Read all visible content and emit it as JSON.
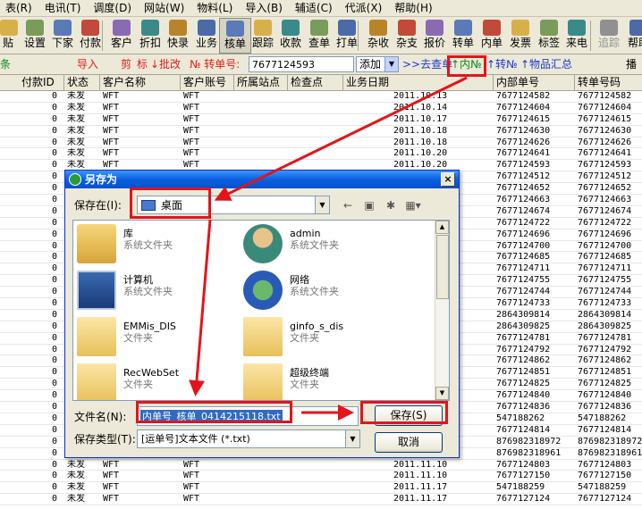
{
  "menu": [
    "表(R)",
    "电讯(T)",
    "调度(D)",
    "网站(W)",
    "物料(L)",
    "导入(B)",
    "辅适(C)",
    "代派(X)",
    "帮助(H)"
  ],
  "toolbar": {
    "items": [
      "贴",
      "设置",
      "下家",
      "付款",
      "客户",
      "折扣",
      "快录",
      "业务",
      "核单",
      "跟踪",
      "收款",
      "查单",
      "打单",
      "杂收",
      "杂支",
      "报价",
      "转单",
      "内单",
      "发票",
      "标签",
      "来电",
      "追踪",
      "帮助"
    ]
  },
  "filterbar": {
    "leading": "条",
    "import_label": "导入",
    "cut_label": "剪",
    "mark_label": "标",
    "batch_label": "↓批改",
    "tracking_label": "№ 转单号:",
    "tracking_value": "7677124593",
    "add_value": "添加",
    "goto_label": ">>去查单",
    "inner_label": "↑内№",
    "transfer_label": "↑转№",
    "summary_label": "↑物品汇总",
    "trailing": "播"
  },
  "grid": {
    "columns": [
      "付款ID",
      "状态",
      "客户名称",
      "客户账号",
      "所属站点",
      "检查点",
      "业务日期",
      "内部单号",
      "转单号码"
    ],
    "rows": [
      [
        "0",
        "未发",
        "WFT",
        "WFT",
        "",
        "",
        "2011.10.13",
        "7677124582",
        "7677124582"
      ],
      [
        "0",
        "未发",
        "WFT",
        "WFT",
        "",
        "",
        "2011.10.14",
        "7677124604",
        "7677124604"
      ],
      [
        "0",
        "未发",
        "WFT",
        "WFT",
        "",
        "",
        "2011.10.17",
        "7677124615",
        "7677124615"
      ],
      [
        "0",
        "未发",
        "WFT",
        "WFT",
        "",
        "",
        "2011.10.18",
        "7677124630",
        "7677124630"
      ],
      [
        "0",
        "未发",
        "WFT",
        "WFT",
        "",
        "",
        "2011.10.18",
        "7677124626",
        "7677124626"
      ],
      [
        "0",
        "未发",
        "WFT",
        "WFT",
        "",
        "",
        "2011.10.20",
        "7677124641",
        "7677124641"
      ],
      [
        "0",
        "未发",
        "WFT",
        "WFT",
        "",
        "",
        "2011.10.20",
        "7677124593",
        "7677124593"
      ],
      [
        "0",
        "",
        "",
        "",
        "",
        "",
        "",
        "7677124512",
        "7677124512"
      ],
      [
        "0",
        "",
        "",
        "",
        "",
        "",
        "",
        "7677124652",
        "7677124652"
      ],
      [
        "0",
        "",
        "",
        "",
        "",
        "",
        "",
        "7677124663",
        "7677124663"
      ],
      [
        "0",
        "",
        "",
        "",
        "",
        "",
        "",
        "7677124674",
        "7677124674"
      ],
      [
        "0",
        "",
        "",
        "",
        "",
        "",
        "",
        "7677124722",
        "7677124722"
      ],
      [
        "0",
        "",
        "",
        "",
        "",
        "",
        "",
        "7677124696",
        "7677124696"
      ],
      [
        "0",
        "",
        "",
        "",
        "",
        "",
        "",
        "7677124700",
        "7677124700"
      ],
      [
        "0",
        "",
        "",
        "",
        "",
        "",
        "",
        "7677124685",
        "7677124685"
      ],
      [
        "0",
        "",
        "",
        "",
        "",
        "",
        "",
        "7677124711",
        "7677124711"
      ],
      [
        "0",
        "",
        "",
        "",
        "",
        "",
        "",
        "7677124755",
        "7677124755"
      ],
      [
        "0",
        "",
        "",
        "",
        "",
        "",
        "",
        "7677124744",
        "7677124744"
      ],
      [
        "0",
        "",
        "",
        "",
        "",
        "",
        "",
        "7677124733",
        "7677124733"
      ],
      [
        "0",
        "",
        "",
        "",
        "",
        "",
        "",
        "2864309814",
        "2864309814"
      ],
      [
        "0",
        "",
        "",
        "",
        "",
        "",
        "",
        "2864309825",
        "2864309825"
      ],
      [
        "0",
        "",
        "",
        "",
        "",
        "",
        "",
        "7677124781",
        "7677124781"
      ],
      [
        "0",
        "",
        "",
        "",
        "",
        "",
        "",
        "7677124792",
        "7677124792"
      ],
      [
        "0",
        "",
        "",
        "",
        "",
        "",
        "",
        "7677124862",
        "7677124862"
      ],
      [
        "0",
        "",
        "",
        "",
        "",
        "",
        "",
        "7677124851",
        "7677124851"
      ],
      [
        "0",
        "",
        "",
        "",
        "",
        "",
        "",
        "7677124825",
        "7677124825"
      ],
      [
        "0",
        "",
        "",
        "",
        "",
        "",
        "",
        "7677124840",
        "7677124840"
      ],
      [
        "0",
        "",
        "",
        "",
        "",
        "",
        "",
        "7677124836",
        "7677124836"
      ],
      [
        "0",
        "",
        "",
        "",
        "",
        "",
        "",
        "547188262",
        "547188262"
      ],
      [
        "0",
        "",
        "",
        "",
        "",
        "",
        "",
        "7677124814",
        "7677124814"
      ],
      [
        "0",
        "",
        "",
        "",
        "",
        "",
        "",
        "876982318972",
        "876982318972"
      ],
      [
        "0",
        "",
        "",
        "",
        "",
        "",
        "",
        "876982318961",
        "876982318961"
      ],
      [
        "0",
        "未发",
        "WFT",
        "WFT",
        "",
        "",
        "2011.11.10",
        "7677124803",
        "7677124803"
      ],
      [
        "0",
        "未发",
        "WFT",
        "WFT",
        "",
        "",
        "2011.11.10",
        "7677127150",
        "7677127150"
      ],
      [
        "0",
        "未发",
        "WFT",
        "WFT",
        "",
        "",
        "2011.11.17",
        "547188259",
        "547188259"
      ],
      [
        "0",
        "未发",
        "WFT",
        "WFT",
        "",
        "",
        "2011.11.17",
        "7677127124",
        "7677127124"
      ]
    ]
  },
  "dialog": {
    "title": "另存为",
    "close": "×",
    "save_in_label": "保存在(I):",
    "save_in_value": "桌面",
    "nav_icons": [
      "←",
      "▣",
      "✱",
      "▦▾"
    ],
    "items": [
      {
        "name": "库",
        "type": "系统文件夹",
        "icon": "library-icon"
      },
      {
        "name": "admin",
        "type": "系统文件夹",
        "icon": "user-icon"
      },
      {
        "name": "计算机",
        "type": "系统文件夹",
        "icon": "computer-icon"
      },
      {
        "name": "网络",
        "type": "系统文件夹",
        "icon": "network-icon"
      },
      {
        "name": "EMMis_DIS",
        "type": "文件夹",
        "icon": "folder-icon"
      },
      {
        "name": "ginfo_s_dis",
        "type": "文件夹",
        "icon": "folder-icon"
      },
      {
        "name": "RecWebSet",
        "type": "文件夹",
        "icon": "folder-icon"
      },
      {
        "name": "超级终端",
        "type": "文件夹",
        "icon": "folder-icon"
      }
    ],
    "filename_label": "文件名(N):",
    "filename_value": "内单号_核单_0414215118.txt",
    "filetype_label": "保存类型(T):",
    "filetype_value": "[运单号]文本文件 (*.txt)",
    "save_button": "保存(S)",
    "cancel_button": "取消"
  },
  "annotation_color": "#e4141a"
}
